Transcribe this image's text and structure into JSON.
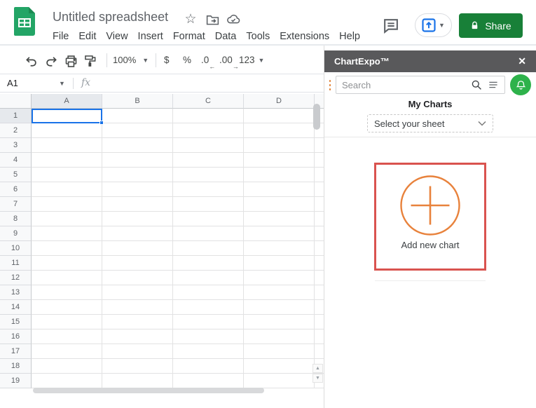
{
  "colors": {
    "selection-blue": "#1a73e8",
    "share-green": "#188038",
    "logo-green": "#23a566",
    "panel-header-gray": "#59595b",
    "brand-orange": "#e07d2e",
    "card-border-red": "#d9534f",
    "bell-green": "#2eb24b"
  },
  "titlebar": {
    "title": "Untitled spreadsheet",
    "share_label": "Share"
  },
  "menus": [
    "File",
    "Edit",
    "View",
    "Insert",
    "Format",
    "Data",
    "Tools",
    "Extensions",
    "Help"
  ],
  "toolbar": {
    "zoom_level": "100%",
    "currency": "$",
    "percent": "%",
    "decrease_decimal": ".0",
    "decrease_decimal_arrow": "←",
    "increase_decimal": ".00",
    "increase_decimal_arrow": "→",
    "more_formats": "123"
  },
  "formula_bar": {
    "cell_reference": "A1",
    "fx_label": "fx"
  },
  "grid": {
    "column_headers": [
      "A",
      "B",
      "C",
      "D"
    ],
    "row_headers": [
      "1",
      "2",
      "3",
      "4",
      "5",
      "6",
      "7",
      "8",
      "9",
      "10",
      "11",
      "12",
      "13",
      "14",
      "15",
      "16",
      "17",
      "18",
      "19"
    ],
    "selected_cell": "A1"
  },
  "panel": {
    "title": "ChartExpo™",
    "close_label": "✕",
    "search_placeholder": "Search",
    "section_title": "My Charts",
    "sheet_selector_value": "Select your sheet",
    "add_chart_label": "Add new chart"
  }
}
